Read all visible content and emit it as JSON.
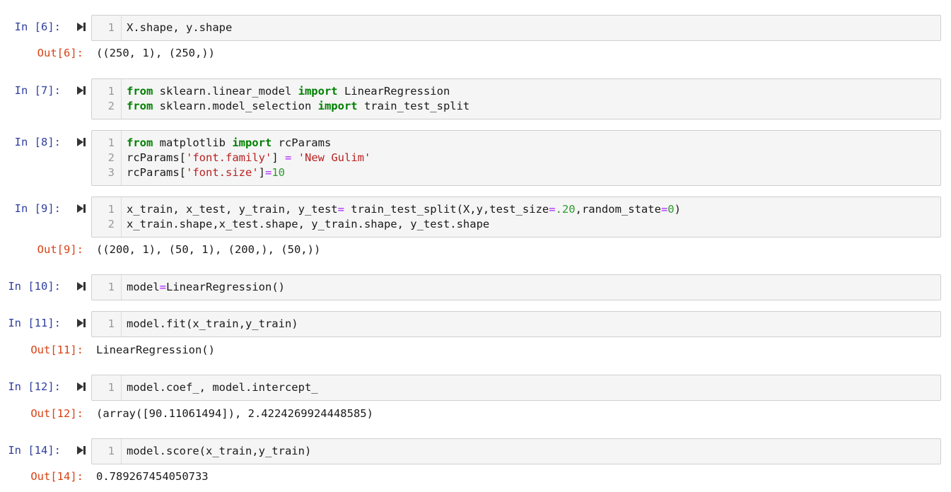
{
  "cells": [
    {
      "in_prompt": "In [6]:",
      "lines": [
        {
          "n": "1",
          "tokens": [
            {
              "t": "X.shape, y.shape",
              "c": ""
            }
          ]
        }
      ],
      "out_prompt": "Out[6]:",
      "out_text": "((250, 1), (250,))"
    },
    {
      "in_prompt": "In [7]:",
      "lines": [
        {
          "n": "1",
          "tokens": [
            {
              "t": "from",
              "c": "kw"
            },
            {
              "t": " sklearn.linear_model ",
              "c": ""
            },
            {
              "t": "import",
              "c": "kw"
            },
            {
              "t": " LinearRegression",
              "c": ""
            }
          ]
        },
        {
          "n": "2",
          "tokens": [
            {
              "t": "from",
              "c": "kw"
            },
            {
              "t": " sklearn.model_selection ",
              "c": ""
            },
            {
              "t": "import",
              "c": "kw"
            },
            {
              "t": " train_test_split",
              "c": ""
            }
          ]
        }
      ]
    },
    {
      "in_prompt": "In [8]:",
      "lines": [
        {
          "n": "1",
          "tokens": [
            {
              "t": "from",
              "c": "kw"
            },
            {
              "t": " matplotlib ",
              "c": ""
            },
            {
              "t": "import",
              "c": "kw"
            },
            {
              "t": " rcParams",
              "c": ""
            }
          ]
        },
        {
          "n": "2",
          "tokens": [
            {
              "t": "rcParams[",
              "c": ""
            },
            {
              "t": "'font.family'",
              "c": "str"
            },
            {
              "t": "] ",
              "c": ""
            },
            {
              "t": "=",
              "c": "op"
            },
            {
              "t": " ",
              "c": ""
            },
            {
              "t": "'New Gulim'",
              "c": "str"
            }
          ]
        },
        {
          "n": "3",
          "tokens": [
            {
              "t": "rcParams[",
              "c": ""
            },
            {
              "t": "'font.size'",
              "c": "str"
            },
            {
              "t": "]",
              "c": ""
            },
            {
              "t": "=",
              "c": "op"
            },
            {
              "t": "10",
              "c": "num"
            }
          ]
        }
      ]
    },
    {
      "in_prompt": "In [9]:",
      "lines": [
        {
          "n": "1",
          "tokens": [
            {
              "t": "x_train, x_test, y_train, y_test",
              "c": ""
            },
            {
              "t": "=",
              "c": "op"
            },
            {
              "t": " train_test_split(X,y,test_size",
              "c": ""
            },
            {
              "t": "=",
              "c": "op"
            },
            {
              "t": ".20",
              "c": "num"
            },
            {
              "t": ",random_state",
              "c": ""
            },
            {
              "t": "=",
              "c": "op"
            },
            {
              "t": "0",
              "c": "num"
            },
            {
              "t": ")",
              "c": ""
            }
          ]
        },
        {
          "n": "2",
          "tokens": [
            {
              "t": "x_train.shape,x_test.shape, y_train.shape, y_test.shape",
              "c": ""
            }
          ]
        }
      ],
      "out_prompt": "Out[9]:",
      "out_text": "((200, 1), (50, 1), (200,), (50,))"
    },
    {
      "in_prompt": "In [10]:",
      "lines": [
        {
          "n": "1",
          "tokens": [
            {
              "t": "model",
              "c": ""
            },
            {
              "t": "=",
              "c": "op"
            },
            {
              "t": "LinearRegression()",
              "c": ""
            }
          ]
        }
      ]
    },
    {
      "in_prompt": "In [11]:",
      "lines": [
        {
          "n": "1",
          "tokens": [
            {
              "t": "model.fit(x_train,y_train)",
              "c": ""
            }
          ]
        }
      ],
      "out_prompt": "Out[11]:",
      "out_text": "LinearRegression()"
    },
    {
      "in_prompt": "In [12]:",
      "lines": [
        {
          "n": "1",
          "tokens": [
            {
              "t": "model.coef_, model.intercept_",
              "c": ""
            }
          ]
        }
      ],
      "out_prompt": "Out[12]:",
      "out_text": "(array([90.11061494]), 2.4224269924448585)"
    },
    {
      "in_prompt": "In [14]:",
      "lines": [
        {
          "n": "1",
          "tokens": [
            {
              "t": "model.score(x_train,y_train)",
              "c": ""
            }
          ]
        }
      ],
      "out_prompt": "Out[14]:",
      "out_text": "0.789267454050733"
    }
  ],
  "icons": {
    "run": "run-cell-icon"
  },
  "colors": {
    "in_prompt": "#303f9f",
    "out_prompt": "#d84315",
    "keyword": "#008000",
    "string": "#ba2121",
    "number": "#2e9a2e",
    "operator": "#aa22ff",
    "cell_bg": "#f5f5f5"
  }
}
